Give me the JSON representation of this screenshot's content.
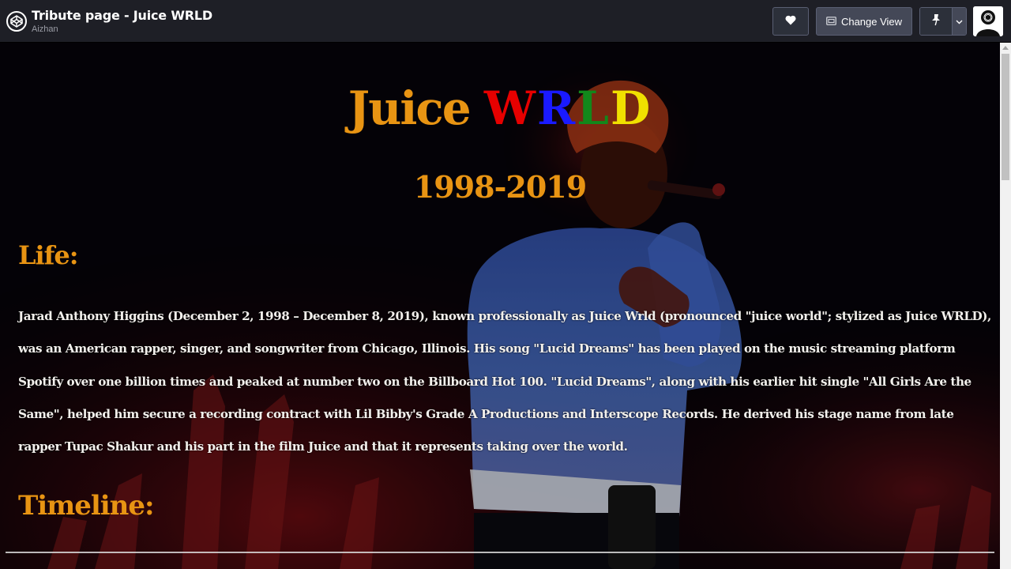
{
  "header": {
    "title": "Tribute page - Juice WRLD",
    "author": "Aizhan",
    "change_view_label": "Change View",
    "icons": [
      "codepen-logo-icon",
      "heart-icon",
      "layout-icon",
      "pin-icon",
      "chevron-down-icon",
      "user-avatar-icon"
    ]
  },
  "tribute": {
    "title_juice": "Juice",
    "title_letters": [
      {
        "char": "W",
        "color": "#e60000"
      },
      {
        "char": "R",
        "color": "#1a1aff"
      },
      {
        "char": "L",
        "color": "#12881b"
      },
      {
        "char": "D",
        "color": "#f0e000"
      }
    ],
    "years": "1998-2019",
    "life_heading": "Life:",
    "bio": "Jarad Anthony Higgins (December 2, 1998 – December 8, 2019), known professionally as Juice Wrld (pronounced \"juice world\"; stylized as Juice WRLD), was an American rapper, singer, and songwriter from Chicago, Illinois. His song \"Lucid Dreams\" has been played on the music streaming platform Spotify over one billion times and peaked at number two on the Billboard Hot 100. \"Lucid Dreams\", along with his earlier hit single \"All Girls Are the Same\", helped him secure a recording contract with Lil Bibby's Grade A Productions and Interscope Records. He derived his stage name from late rapper Tupac Shakur and his part in the film Juice and that it represents taking over the world.",
    "timeline_heading": "Timeline:",
    "accent_color": "#e89413"
  }
}
